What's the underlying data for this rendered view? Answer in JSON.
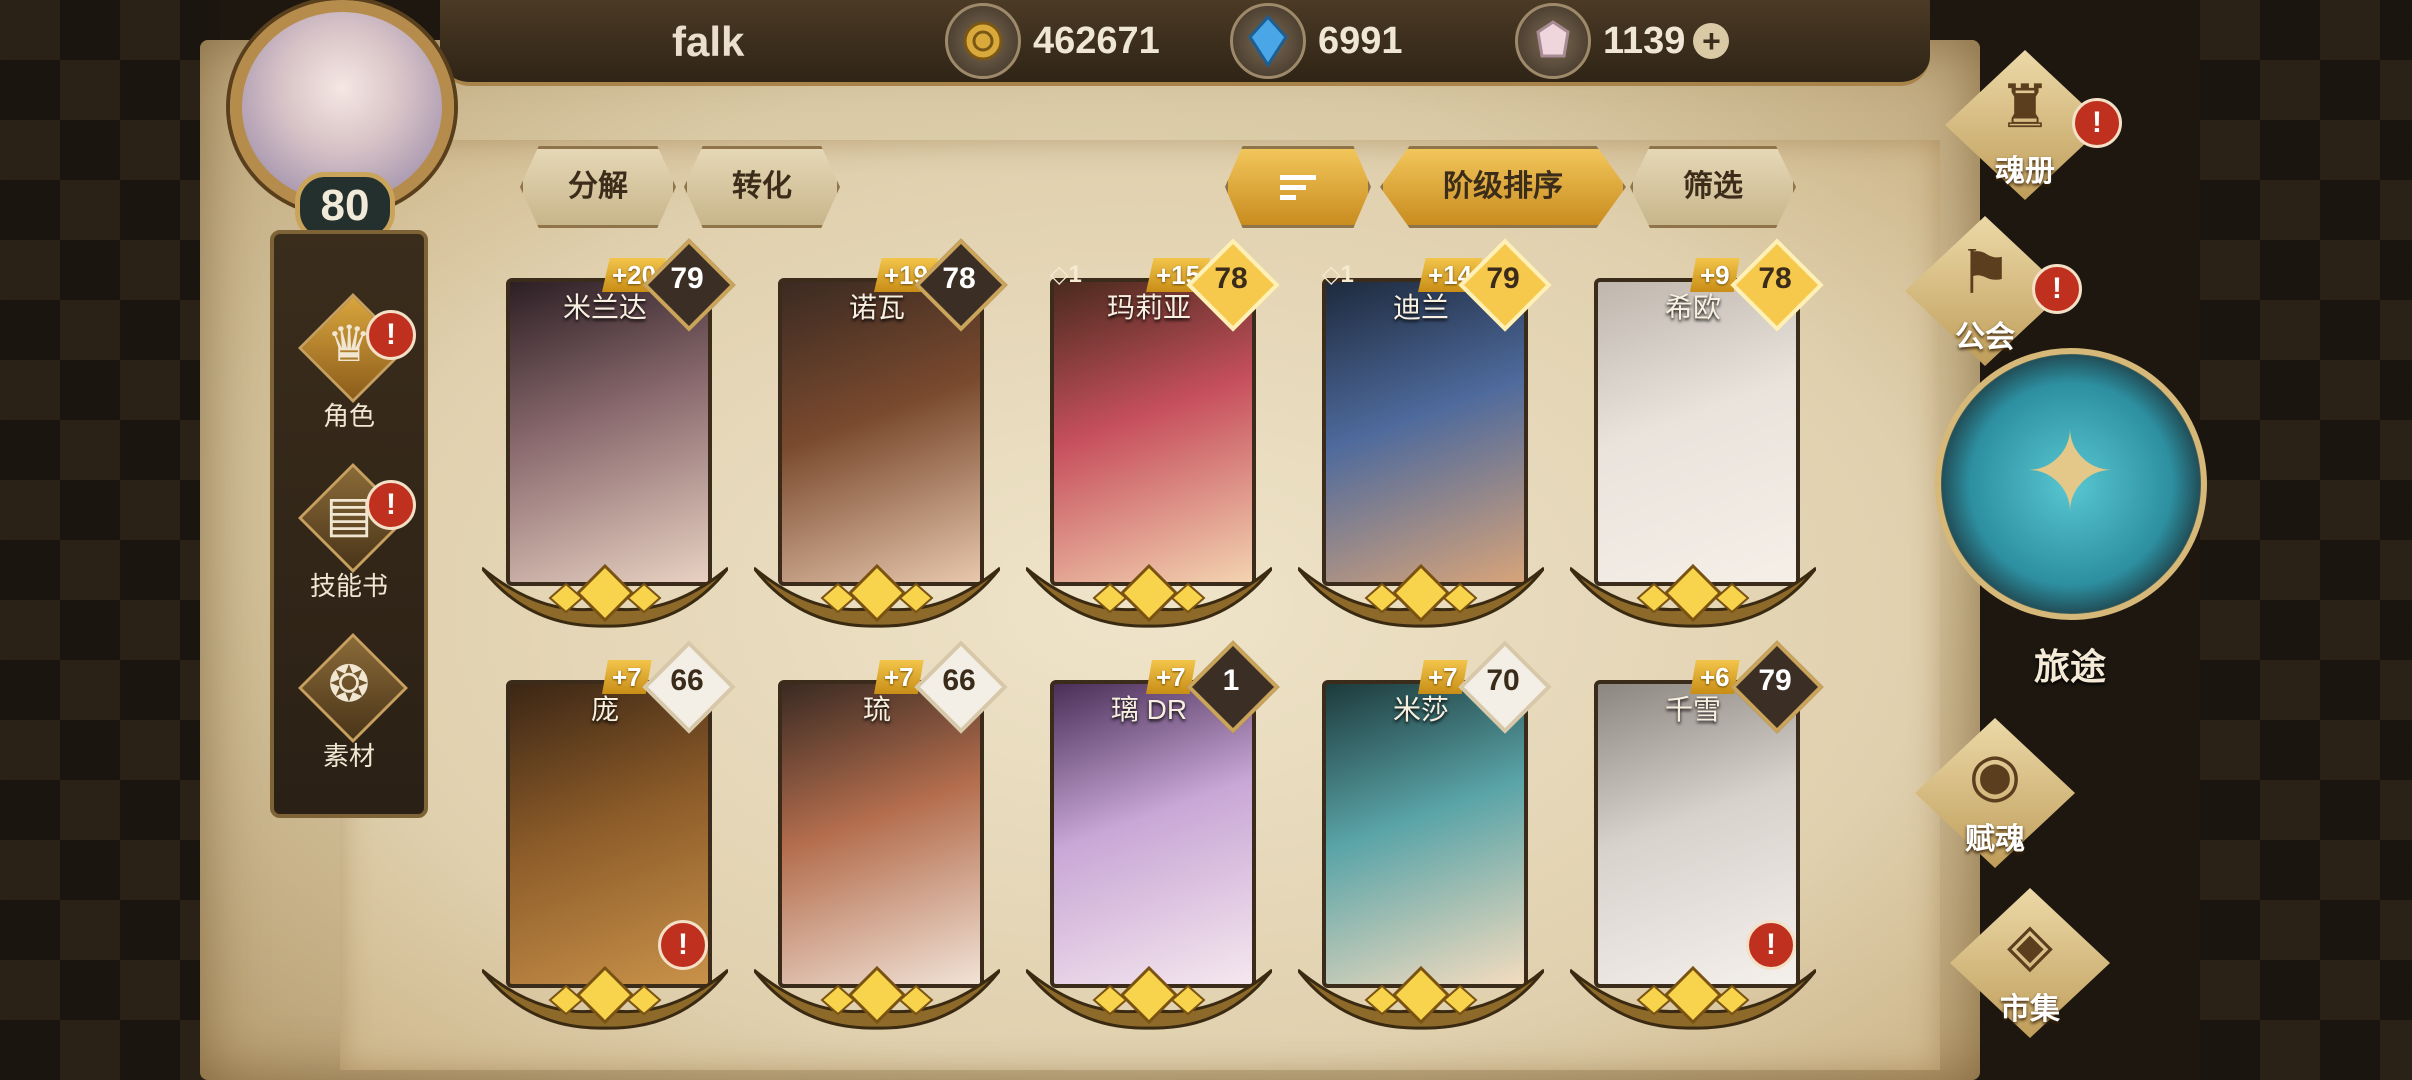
{
  "player": {
    "name": "falk",
    "level": "80"
  },
  "currencies": [
    {
      "icon": "gold-coin-icon",
      "value": "462671"
    },
    {
      "icon": "blue-crystal-icon",
      "value": "6991"
    },
    {
      "icon": "gem-icon",
      "value": "1139",
      "plus": "+"
    }
  ],
  "left_menu": [
    {
      "label": "角色",
      "icon": "character-icon",
      "alert": "!"
    },
    {
      "label": "技能书",
      "icon": "skill-book-icon",
      "alert": "!"
    },
    {
      "label": "素材",
      "icon": "materials-icon"
    }
  ],
  "toolbar": {
    "decompose": "分解",
    "convert": "转化",
    "sort_icon": "sort-icon",
    "sort_order": "阶级排序",
    "filter": "筛选"
  },
  "heroes": [
    {
      "name": "米兰达",
      "bonus": "+20",
      "level": "79",
      "soul": "",
      "colors": [
        "#2c1f24",
        "#8a6a6e",
        "#e8d1c2"
      ]
    },
    {
      "name": "诺瓦",
      "bonus": "+19",
      "level": "78",
      "soul": "",
      "colors": [
        "#3b2a22",
        "#7a4a2e",
        "#e7c7ad"
      ]
    },
    {
      "name": "玛莉亚",
      "bonus": "+15",
      "level": "78",
      "soul": "◇1",
      "colors": [
        "#4a2a1c",
        "#c7505e",
        "#f3d3b0"
      ]
    },
    {
      "name": "迪兰",
      "bonus": "+14",
      "level": "79",
      "soul": "◇1",
      "colors": [
        "#1e2a3d",
        "#4e6a9c",
        "#d7a47a"
      ]
    },
    {
      "name": "希欧",
      "bonus": "+9",
      "level": "78",
      "soul": "",
      "colors": [
        "#bfb6ad",
        "#e9e3dc",
        "#f5efe8"
      ]
    },
    {
      "name": "庞",
      "bonus": "+7",
      "level": "66",
      "soul": "",
      "alert": "!",
      "colors": [
        "#3b2615",
        "#8a5a28",
        "#c9924a"
      ]
    },
    {
      "name": "琉",
      "bonus": "+7",
      "level": "66",
      "soul": "",
      "colors": [
        "#3a2a22",
        "#b46e4e",
        "#f1e2d6"
      ]
    },
    {
      "name": "璃 DR",
      "bonus": "+7",
      "level": "1",
      "soul": "",
      "colors": [
        "#4a2f58",
        "#c9a7d6",
        "#f5e7ee"
      ]
    },
    {
      "name": "米莎",
      "bonus": "+7",
      "level": "70",
      "soul": "",
      "colors": [
        "#1d3a3c",
        "#5aa4a8",
        "#f3dcbf"
      ]
    },
    {
      "name": "千雪",
      "bonus": "+6",
      "level": "79",
      "soul": "",
      "alert": "!",
      "colors": [
        "#8c8681",
        "#d8d2cc",
        "#f4f0ec"
      ]
    }
  ],
  "right_nav": [
    {
      "label": "魂册",
      "icon": "soul-book-icon",
      "alert": "!"
    },
    {
      "label": "公会",
      "icon": "guild-icon",
      "alert": "!"
    },
    {
      "label": "旅途",
      "icon": "journey-icon"
    },
    {
      "label": "赋魂",
      "icon": "soul-infuse-icon"
    },
    {
      "label": "市集",
      "icon": "market-icon"
    }
  ]
}
